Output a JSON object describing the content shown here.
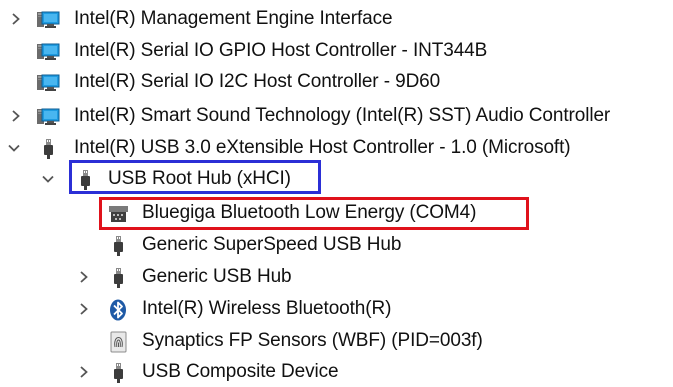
{
  "device_tree": {
    "items": [
      {
        "label": "Intel(R) Management Engine Interface",
        "icon": "system-device-icon",
        "expander": "collapsed"
      },
      {
        "label": "Intel(R) Serial IO GPIO Host Controller - INT344B",
        "icon": "system-device-icon",
        "expander": "none"
      },
      {
        "label": "Intel(R) Serial IO I2C Host Controller - 9D60",
        "icon": "system-device-icon",
        "expander": "none"
      },
      {
        "label": "Intel(R) Smart Sound Technology (Intel(R) SST) Audio Controller",
        "icon": "system-device-icon",
        "expander": "collapsed"
      },
      {
        "label": "Intel(R) USB 3.0 eXtensible Host Controller - 1.0 (Microsoft)",
        "icon": "usb-plug-icon",
        "expander": "expanded"
      },
      {
        "label": "USB Root Hub (xHCI)",
        "icon": "usb-plug-icon",
        "expander": "expanded"
      },
      {
        "label": "Bluegiga Bluetooth Low Energy (COM4)",
        "icon": "serial-port-icon",
        "expander": "none"
      },
      {
        "label": "Generic SuperSpeed USB Hub",
        "icon": "usb-plug-icon",
        "expander": "none"
      },
      {
        "label": "Generic USB Hub",
        "icon": "usb-plug-icon",
        "expander": "collapsed"
      },
      {
        "label": "Intel(R) Wireless Bluetooth(R)",
        "icon": "bluetooth-icon",
        "expander": "collapsed"
      },
      {
        "label": "Synaptics FP Sensors (WBF) (PID=003f)",
        "icon": "fingerprint-icon",
        "expander": "none"
      },
      {
        "label": "USB Composite Device",
        "icon": "usb-plug-icon",
        "expander": "collapsed"
      }
    ]
  },
  "highlights": {
    "blue_color": "#2b2fd6",
    "red_color": "#e0121b"
  },
  "colors": {
    "text": "#111111",
    "chevron": "#555555",
    "monitor_blue": "#1e9be0",
    "bluetooth_blue": "#1f5aa6"
  }
}
